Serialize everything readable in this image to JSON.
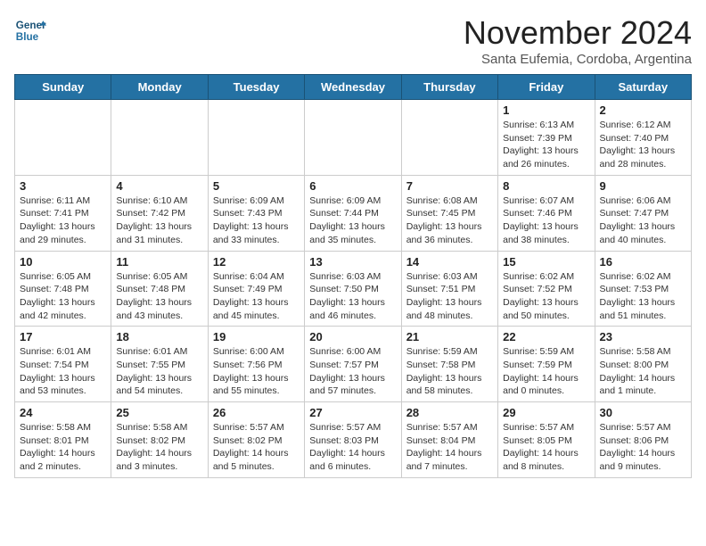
{
  "header": {
    "logo_line1": "General",
    "logo_line2": "Blue",
    "month_title": "November 2024",
    "location": "Santa Eufemia, Cordoba, Argentina"
  },
  "days_of_week": [
    "Sunday",
    "Monday",
    "Tuesday",
    "Wednesday",
    "Thursday",
    "Friday",
    "Saturday"
  ],
  "weeks": [
    [
      {
        "day": "",
        "content": ""
      },
      {
        "day": "",
        "content": ""
      },
      {
        "day": "",
        "content": ""
      },
      {
        "day": "",
        "content": ""
      },
      {
        "day": "",
        "content": ""
      },
      {
        "day": "1",
        "content": "Sunrise: 6:13 AM\nSunset: 7:39 PM\nDaylight: 13 hours\nand 26 minutes."
      },
      {
        "day": "2",
        "content": "Sunrise: 6:12 AM\nSunset: 7:40 PM\nDaylight: 13 hours\nand 28 minutes."
      }
    ],
    [
      {
        "day": "3",
        "content": "Sunrise: 6:11 AM\nSunset: 7:41 PM\nDaylight: 13 hours\nand 29 minutes."
      },
      {
        "day": "4",
        "content": "Sunrise: 6:10 AM\nSunset: 7:42 PM\nDaylight: 13 hours\nand 31 minutes."
      },
      {
        "day": "5",
        "content": "Sunrise: 6:09 AM\nSunset: 7:43 PM\nDaylight: 13 hours\nand 33 minutes."
      },
      {
        "day": "6",
        "content": "Sunrise: 6:09 AM\nSunset: 7:44 PM\nDaylight: 13 hours\nand 35 minutes."
      },
      {
        "day": "7",
        "content": "Sunrise: 6:08 AM\nSunset: 7:45 PM\nDaylight: 13 hours\nand 36 minutes."
      },
      {
        "day": "8",
        "content": "Sunrise: 6:07 AM\nSunset: 7:46 PM\nDaylight: 13 hours\nand 38 minutes."
      },
      {
        "day": "9",
        "content": "Sunrise: 6:06 AM\nSunset: 7:47 PM\nDaylight: 13 hours\nand 40 minutes."
      }
    ],
    [
      {
        "day": "10",
        "content": "Sunrise: 6:05 AM\nSunset: 7:48 PM\nDaylight: 13 hours\nand 42 minutes."
      },
      {
        "day": "11",
        "content": "Sunrise: 6:05 AM\nSunset: 7:48 PM\nDaylight: 13 hours\nand 43 minutes."
      },
      {
        "day": "12",
        "content": "Sunrise: 6:04 AM\nSunset: 7:49 PM\nDaylight: 13 hours\nand 45 minutes."
      },
      {
        "day": "13",
        "content": "Sunrise: 6:03 AM\nSunset: 7:50 PM\nDaylight: 13 hours\nand 46 minutes."
      },
      {
        "day": "14",
        "content": "Sunrise: 6:03 AM\nSunset: 7:51 PM\nDaylight: 13 hours\nand 48 minutes."
      },
      {
        "day": "15",
        "content": "Sunrise: 6:02 AM\nSunset: 7:52 PM\nDaylight: 13 hours\nand 50 minutes."
      },
      {
        "day": "16",
        "content": "Sunrise: 6:02 AM\nSunset: 7:53 PM\nDaylight: 13 hours\nand 51 minutes."
      }
    ],
    [
      {
        "day": "17",
        "content": "Sunrise: 6:01 AM\nSunset: 7:54 PM\nDaylight: 13 hours\nand 53 minutes."
      },
      {
        "day": "18",
        "content": "Sunrise: 6:01 AM\nSunset: 7:55 PM\nDaylight: 13 hours\nand 54 minutes."
      },
      {
        "day": "19",
        "content": "Sunrise: 6:00 AM\nSunset: 7:56 PM\nDaylight: 13 hours\nand 55 minutes."
      },
      {
        "day": "20",
        "content": "Sunrise: 6:00 AM\nSunset: 7:57 PM\nDaylight: 13 hours\nand 57 minutes."
      },
      {
        "day": "21",
        "content": "Sunrise: 5:59 AM\nSunset: 7:58 PM\nDaylight: 13 hours\nand 58 minutes."
      },
      {
        "day": "22",
        "content": "Sunrise: 5:59 AM\nSunset: 7:59 PM\nDaylight: 14 hours\nand 0 minutes."
      },
      {
        "day": "23",
        "content": "Sunrise: 5:58 AM\nSunset: 8:00 PM\nDaylight: 14 hours\nand 1 minute."
      }
    ],
    [
      {
        "day": "24",
        "content": "Sunrise: 5:58 AM\nSunset: 8:01 PM\nDaylight: 14 hours\nand 2 minutes."
      },
      {
        "day": "25",
        "content": "Sunrise: 5:58 AM\nSunset: 8:02 PM\nDaylight: 14 hours\nand 3 minutes."
      },
      {
        "day": "26",
        "content": "Sunrise: 5:57 AM\nSunset: 8:02 PM\nDaylight: 14 hours\nand 5 minutes."
      },
      {
        "day": "27",
        "content": "Sunrise: 5:57 AM\nSunset: 8:03 PM\nDaylight: 14 hours\nand 6 minutes."
      },
      {
        "day": "28",
        "content": "Sunrise: 5:57 AM\nSunset: 8:04 PM\nDaylight: 14 hours\nand 7 minutes."
      },
      {
        "day": "29",
        "content": "Sunrise: 5:57 AM\nSunset: 8:05 PM\nDaylight: 14 hours\nand 8 minutes."
      },
      {
        "day": "30",
        "content": "Sunrise: 5:57 AM\nSunset: 8:06 PM\nDaylight: 14 hours\nand 9 minutes."
      }
    ]
  ]
}
